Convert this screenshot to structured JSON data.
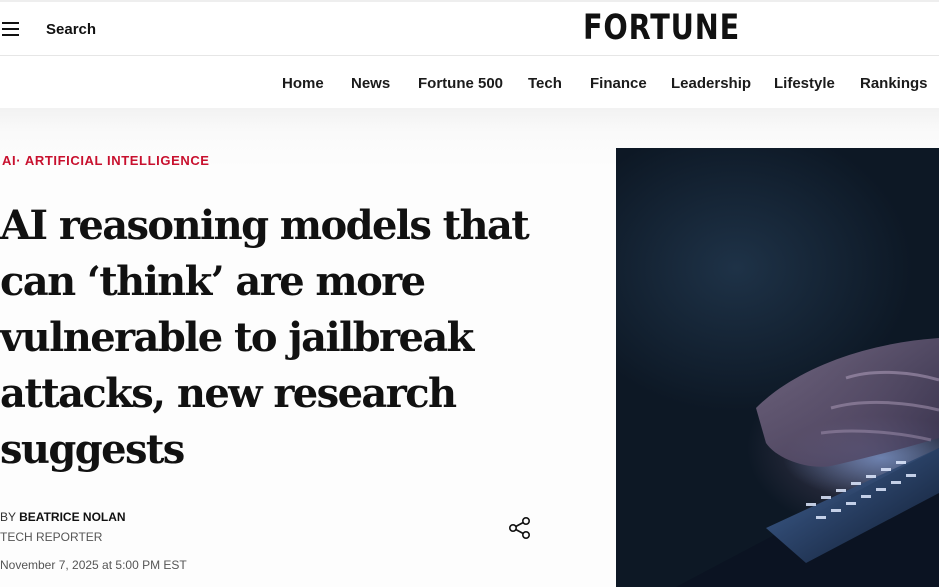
{
  "header": {
    "search_label": "Search",
    "logo_text": "FORTUNE"
  },
  "nav": {
    "items": [
      {
        "label": "Home"
      },
      {
        "label": "News"
      },
      {
        "label": "Fortune 500"
      },
      {
        "label": "Tech"
      },
      {
        "label": "Finance"
      },
      {
        "label": "Leadership"
      },
      {
        "label": "Lifestyle"
      },
      {
        "label": "Rankings"
      }
    ]
  },
  "article": {
    "category": "AI· ARTIFICIAL INTELLIGENCE",
    "headline_lines": [
      "AI reasoning models that",
      "can ‘think’ are more",
      "vulnerable to jailbreak",
      "attacks, new research",
      "suggests"
    ],
    "byline_prefix": "BY ",
    "author": "BEATRICE NOLAN",
    "role": "TECH REPORTER",
    "date": "November 7, 2025 at 5:00 PM EST"
  },
  "colors": {
    "accent": "#c8102e",
    "text": "#111111"
  },
  "icons": [
    "hamburger-menu-icon",
    "share-icon"
  ]
}
